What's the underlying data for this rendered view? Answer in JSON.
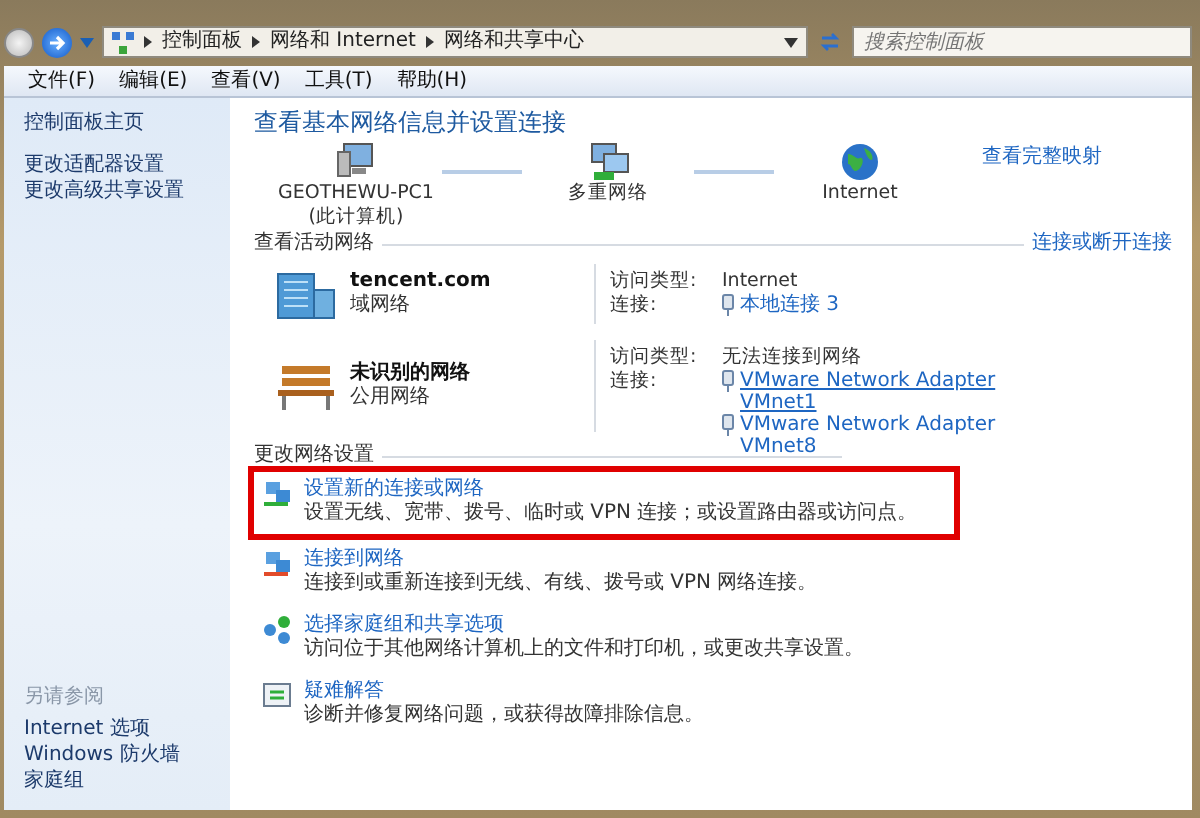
{
  "window": {
    "breadcrumb": [
      "控制面板",
      "网络和 Internet",
      "网络和共享中心"
    ],
    "search": {
      "placeholder": "搜索控制面板"
    }
  },
  "menu": [
    "文件(F)",
    "编辑(E)",
    "查看(V)",
    "工具(T)",
    "帮助(H)"
  ],
  "sidebar": {
    "items": [
      "控制面板主页",
      "更改适配器设置",
      "更改高级共享设置"
    ],
    "see_also_title": "另请参阅",
    "see_also": [
      "Internet 选项",
      "Windows 防火墙",
      "家庭组"
    ]
  },
  "main": {
    "title": "查看基本网络信息并设置连接",
    "map_link": "查看完整映射",
    "map_nodes": [
      {
        "kind": "computer",
        "label": "GEOTHEWU-PC1",
        "sublabel": "(此计算机)"
      },
      {
        "kind": "network",
        "label": "多重网络"
      },
      {
        "kind": "internet",
        "label": "Internet"
      }
    ],
    "active_title": "查看活动网络",
    "active_link": "连接或断开连接",
    "networks": [
      {
        "kind": "domain",
        "name": "tencent.com",
        "type": "域网络",
        "access_label": "访问类型:",
        "access": "Internet",
        "conn_label": "连接:",
        "connections": [
          {
            "text": "本地连接 3",
            "hovered": false
          }
        ]
      },
      {
        "kind": "public",
        "name": "未识别的网络",
        "type": "公用网络",
        "access_label": "访问类型:",
        "access": "无法连接到网络",
        "conn_label": "连接:",
        "connections": [
          {
            "text": "VMware Network Adapter VMnet1",
            "hovered": true
          },
          {
            "text": "VMware Network Adapter VMnet8",
            "hovered": false
          }
        ]
      }
    ],
    "settings_title": "更改网络设置",
    "tasks": [
      {
        "kind": "setup",
        "title": "设置新的连接或网络",
        "desc": "设置无线、宽带、拨号、临时或 VPN 连接；或设置路由器或访问点。",
        "highlighted": true
      },
      {
        "kind": "connect",
        "title": "连接到网络",
        "desc": "连接到或重新连接到无线、有线、拨号或 VPN 网络连接。",
        "highlighted": false
      },
      {
        "kind": "homegroup",
        "title": "选择家庭组和共享选项",
        "desc": "访问位于其他网络计算机上的文件和打印机，或更改共享设置。",
        "highlighted": false
      },
      {
        "kind": "troubleshoot",
        "title": "疑难解答",
        "desc": "诊断并修复网络问题，或获得故障排除信息。",
        "highlighted": false
      }
    ]
  }
}
